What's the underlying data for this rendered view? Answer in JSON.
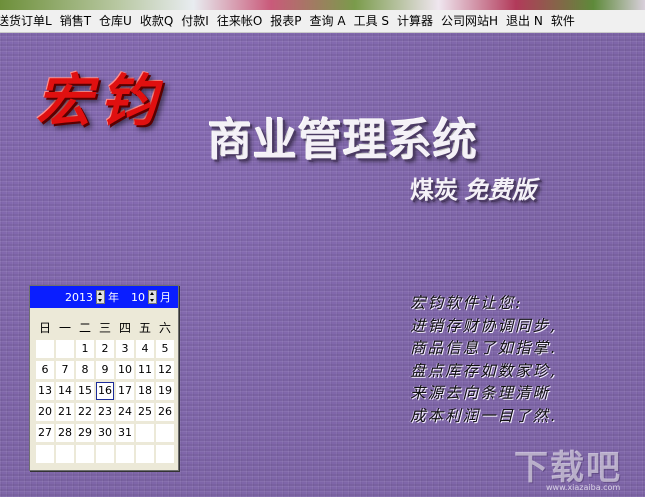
{
  "menubar": {
    "items": [
      {
        "label": "送货订单L"
      },
      {
        "label": "销售T"
      },
      {
        "label": "仓库U"
      },
      {
        "label": "收款Q"
      },
      {
        "label": "付款I"
      },
      {
        "label": "往来帐O"
      },
      {
        "label": "报表P"
      },
      {
        "label": "查询 A"
      },
      {
        "label": "工具 S"
      },
      {
        "label": "计算器"
      },
      {
        "label": "公司网站H"
      },
      {
        "label": "退出 N"
      },
      {
        "label": "软件"
      }
    ]
  },
  "banner": {
    "logo": "宏钧",
    "product_title": "商业管理系统",
    "edition_prefix": "煤炭",
    "edition_suffix": "免费版"
  },
  "calendar": {
    "year": "2013",
    "year_unit": "年",
    "month": "10",
    "month_unit": "月",
    "weekdays": [
      "日",
      "一",
      "二",
      "三",
      "四",
      "五",
      "六"
    ],
    "days": [
      "",
      "",
      "1",
      "2",
      "3",
      "4",
      "5",
      "6",
      "7",
      "8",
      "9",
      "10",
      "11",
      "12",
      "13",
      "14",
      "15",
      "16",
      "17",
      "18",
      "19",
      "20",
      "21",
      "22",
      "23",
      "24",
      "25",
      "26",
      "27",
      "28",
      "29",
      "30",
      "31",
      "",
      "",
      "",
      "",
      "",
      "",
      "",
      "",
      ""
    ],
    "today": "16"
  },
  "poem": {
    "lines": [
      "宏钧软件让您:",
      "进销存财协调同步,",
      "商品信息了如指掌.",
      "盘点库存如数家珍,",
      "来源去向条理清晰",
      "成本利润一目了然."
    ]
  },
  "watermark": {
    "text": "下载吧",
    "sub": "www.xiazaiba.com"
  }
}
